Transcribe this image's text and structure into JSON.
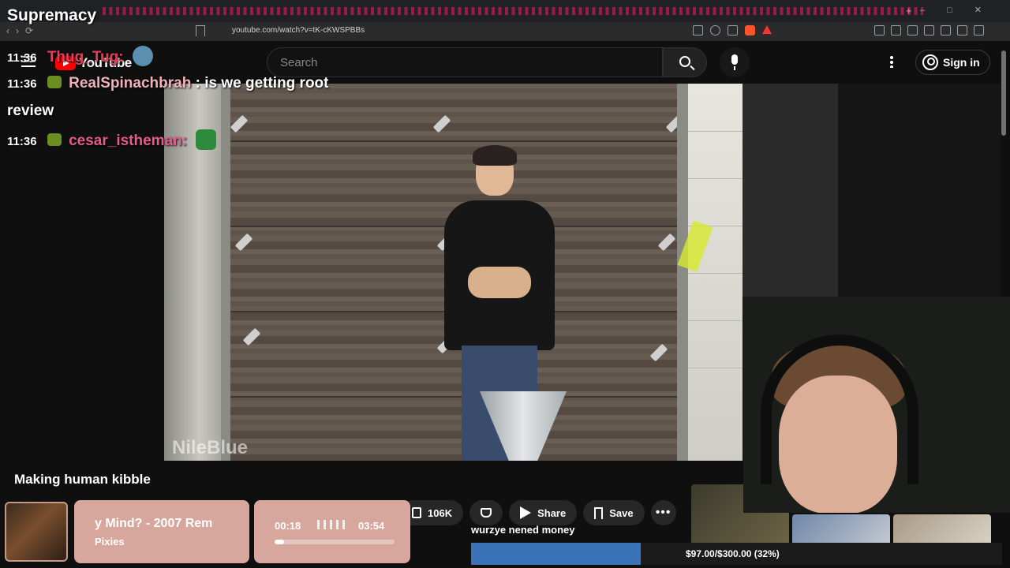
{
  "browser": {
    "url": "youtube.com/watch?v=tK-cKWSPBBs"
  },
  "overlay": {
    "title": "Supremacy"
  },
  "youtube": {
    "logo": "YouTube",
    "search_placeholder": "Search",
    "sign_in": "Sign in",
    "video_title": "Making human kibble",
    "likes": "106K",
    "share_label": "Share",
    "save_label": "Save",
    "watermark": "NileBlue"
  },
  "chat": [
    {
      "time": "11:36",
      "user": "Thug_Tug:",
      "text": "",
      "user_color": "#e0405a"
    },
    {
      "time": "11:36",
      "user": "RealSpinachbrah",
      "text": ": is we getting root review",
      "user_color": "#f0b2b8"
    },
    {
      "time": "11:36",
      "user": "cesar_istheman:",
      "text": "",
      "user_color": "#e55a8f"
    }
  ],
  "music": {
    "song": "y Mind? - 2007 Rem",
    "artist": "Pixies",
    "current_time": "00:18",
    "duration": "03:54",
    "progress": 0.077
  },
  "goal": {
    "label": "wurzye nened money",
    "text": "$97.00/$300.00 (32%)",
    "progress": 0.32
  },
  "colors": {
    "accent_red": "#ff0000",
    "goal_blue": "#3b73b9",
    "music_card": "#d7a79d"
  }
}
